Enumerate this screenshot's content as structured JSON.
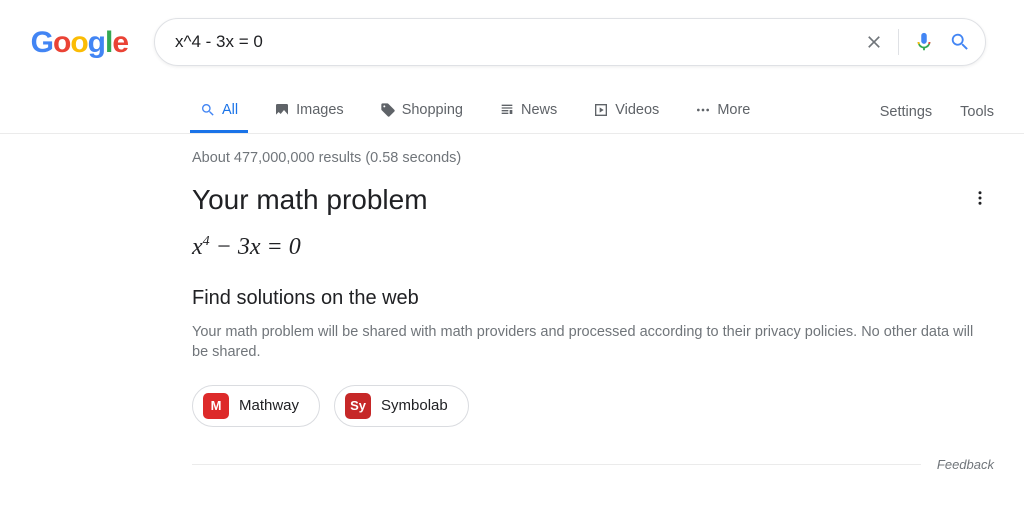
{
  "logo": "Google",
  "search": {
    "query": "x^4 - 3x = 0"
  },
  "tabs": {
    "all": "All",
    "images": "Images",
    "shopping": "Shopping",
    "news": "News",
    "videos": "Videos",
    "more": "More",
    "settings": "Settings",
    "tools": "Tools"
  },
  "stats": "About 477,000,000 results (0.58 seconds)",
  "math_card": {
    "title": "Your math problem",
    "equation_html": "x<sup>4</sup> − 3x = 0",
    "sub_title": "Find solutions on the web",
    "disclaimer": "Your math problem will be shared with math providers and processed according to their privacy policies. No other data will be shared.",
    "providers": {
      "mathway": {
        "label": "Mathway",
        "badge": "M"
      },
      "symbolab": {
        "label": "Symbolab",
        "badge": "Sy"
      }
    }
  },
  "feedback": "Feedback"
}
